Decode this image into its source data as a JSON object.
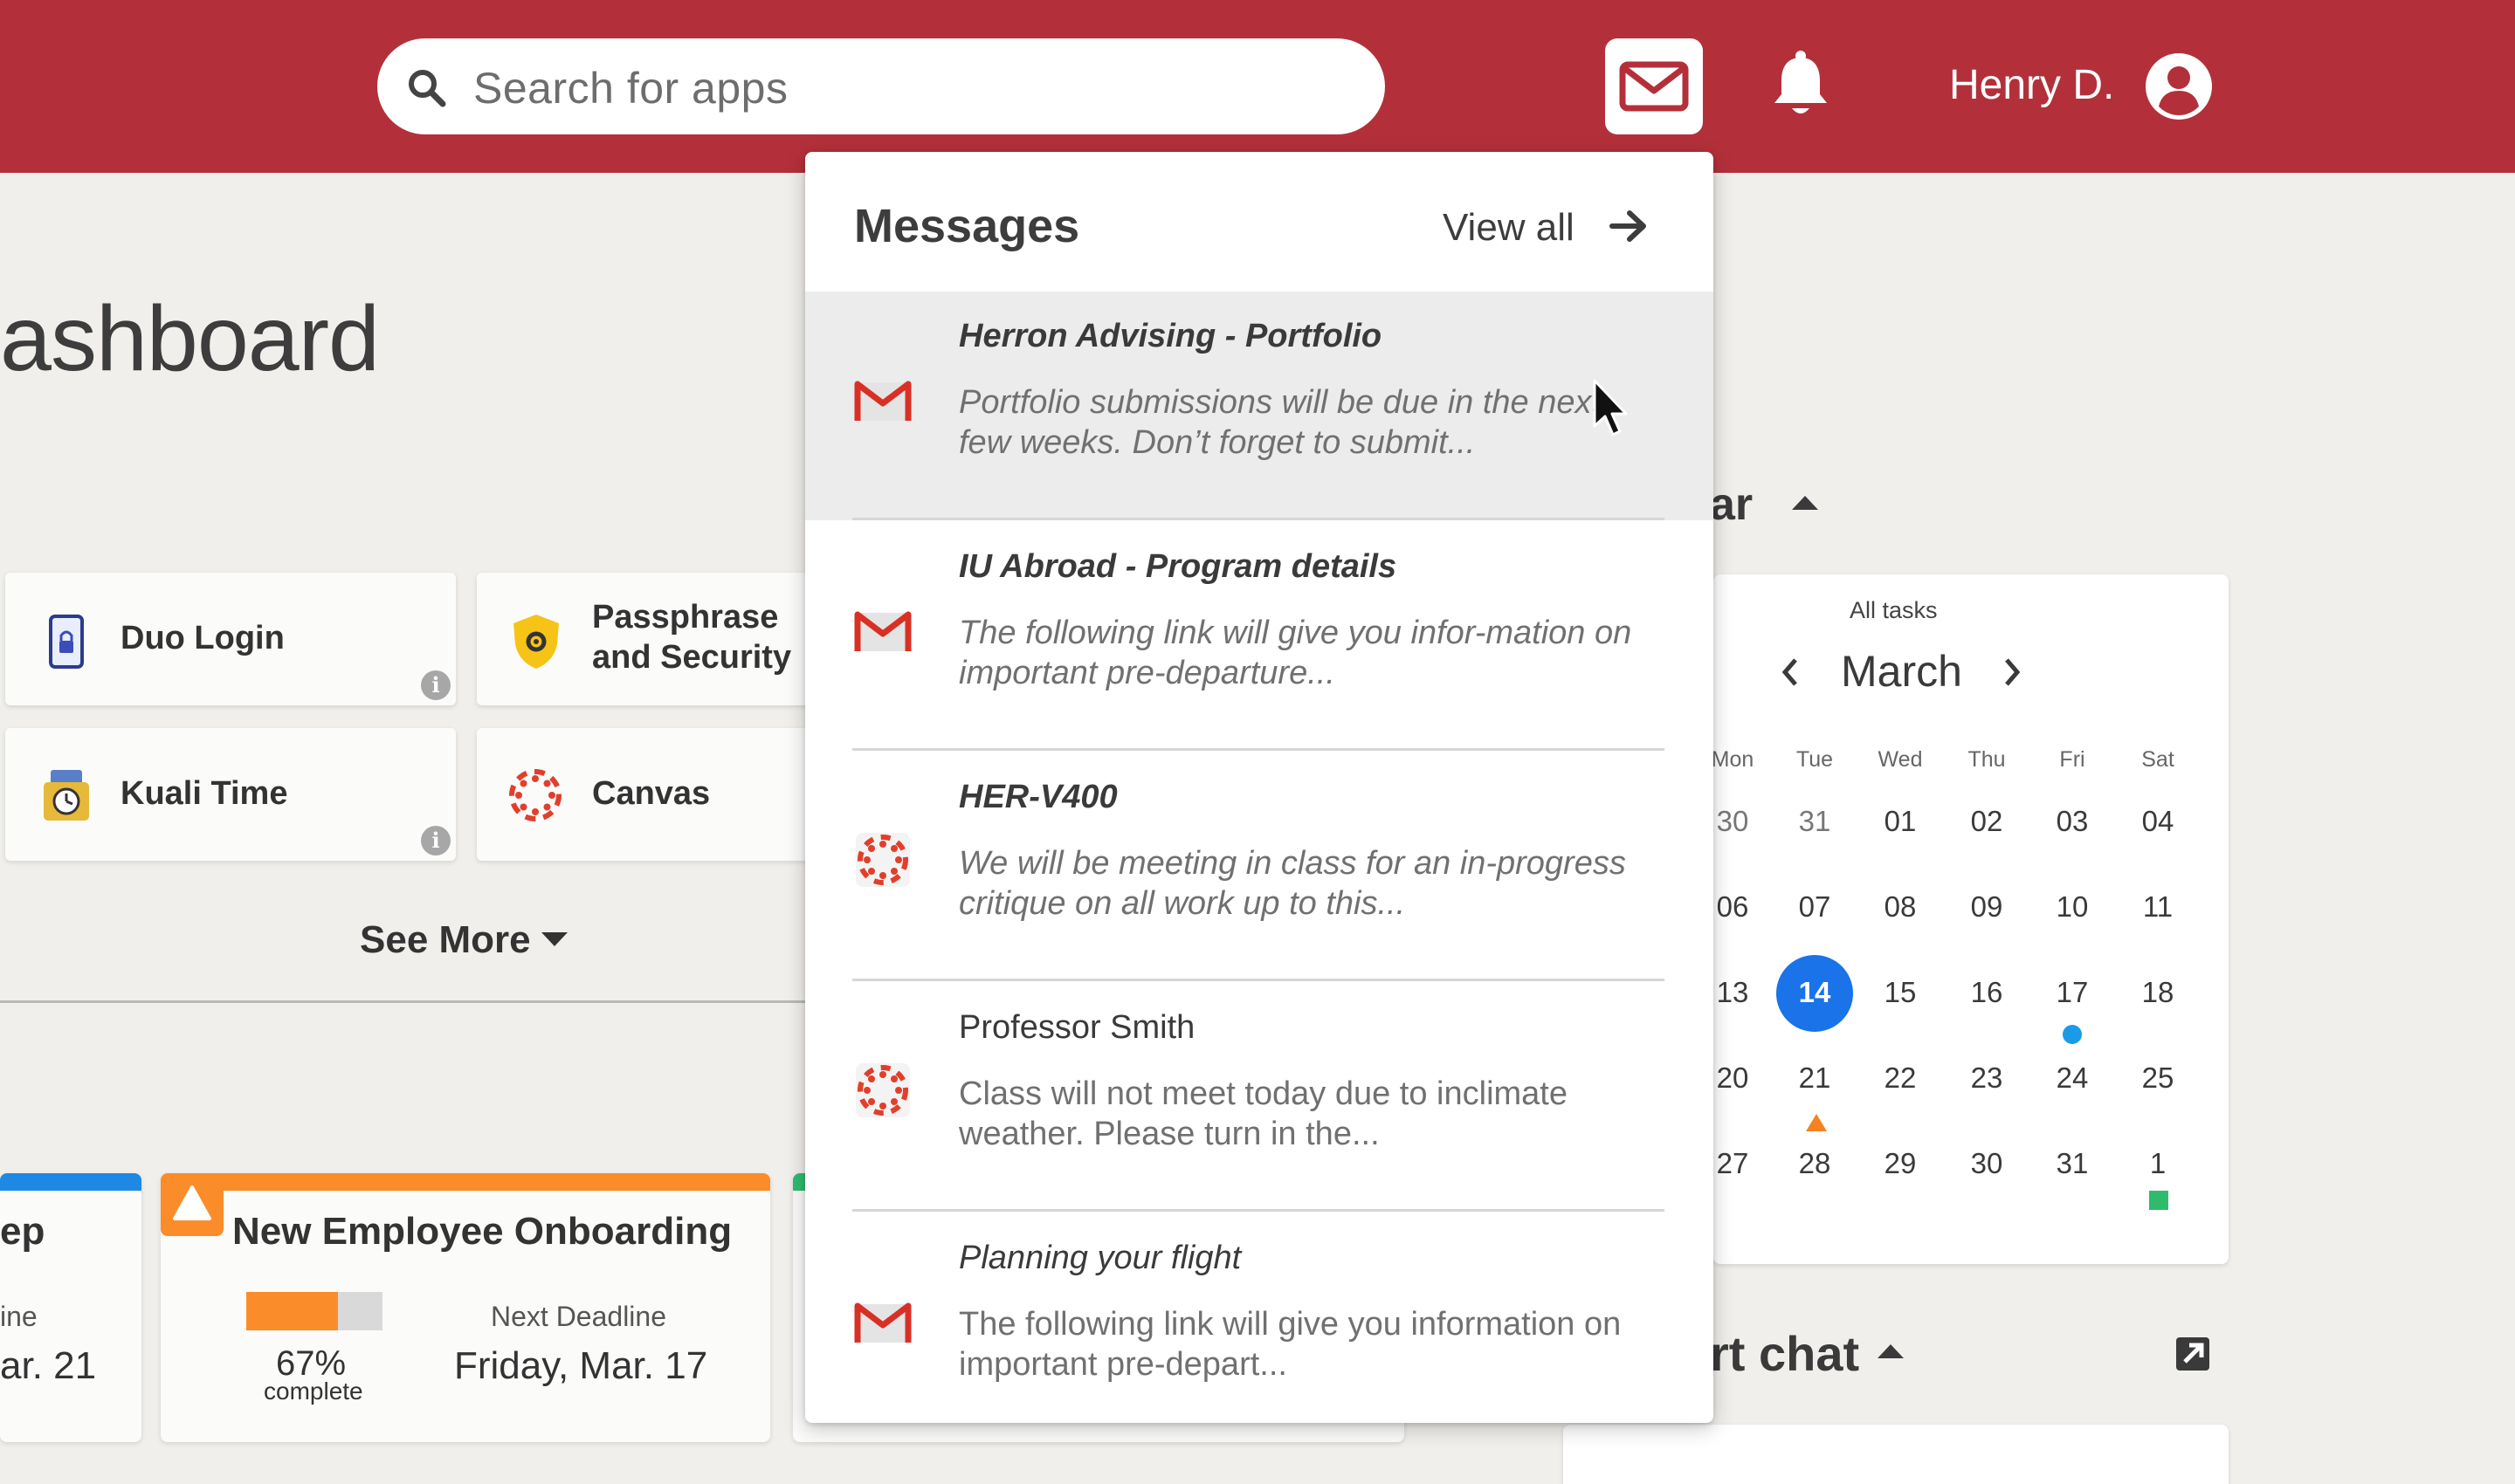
{
  "topbar": {
    "search_placeholder": "Search for apps",
    "user_name": "Henry D.",
    "icons": [
      "search-icon",
      "mail-icon",
      "bell-icon",
      "user-avatar-icon"
    ],
    "brand_color": "#b3303a"
  },
  "dashboard": {
    "title": "ashboard",
    "apps": [
      {
        "label": "Duo Login",
        "icon": "phone-lock-icon"
      },
      {
        "label": "Passphrase and Security",
        "icon": "shield-gear-icon"
      },
      {
        "label": "Kuali Time",
        "icon": "time-clock-icon"
      },
      {
        "label": "Canvas",
        "icon": "canvas-logo-icon"
      }
    ],
    "see_more": "See More",
    "tasks": [
      {
        "title": "ep",
        "label": "ine",
        "deadline": "ar. 21",
        "bar_color": "#1e88e5"
      },
      {
        "title": "New Employee Onboarding",
        "progress_percent": 67,
        "progress_text": "67%",
        "progress_sub": "complete",
        "deadline_label": "Next Deadline",
        "deadline": "Friday, Mar. 17",
        "bar_color": "#fb8c2a"
      },
      {
        "title": "",
        "bar_color": "#2ebb6e"
      }
    ]
  },
  "calendar": {
    "heading": "ar",
    "filter": "All tasks",
    "month": "March",
    "weekdays": [
      "Mon",
      "Tue",
      "Wed",
      "Thu",
      "Fri",
      "Sat"
    ],
    "weeks": [
      [
        "30",
        "31",
        "01",
        "02",
        "03",
        "04"
      ],
      [
        "06",
        "07",
        "08",
        "09",
        "10",
        "11"
      ],
      [
        "13",
        "14",
        "15",
        "16",
        "17",
        "18"
      ],
      [
        "20",
        "21",
        "22",
        "23",
        "24",
        "25"
      ],
      [
        "27",
        "28",
        "29",
        "30",
        "31",
        "1"
      ]
    ],
    "today": "14",
    "marker_colors": {
      "blue": "#1a9be8",
      "orange": "#f58220",
      "green": "#2ebb6e"
    }
  },
  "chat": {
    "heading": "rt chat"
  },
  "messages": {
    "title": "Messages",
    "view_all": "View all",
    "items": [
      {
        "app": "gmail",
        "from": "Herron Advising - Portfolio",
        "preview": "Portfolio submissions will be due in the next few weeks. Don’t forget to submit...",
        "unread": true,
        "active": true
      },
      {
        "app": "gmail",
        "from": "IU Abroad - Program details",
        "preview": "The following link will give you infor-mation on important pre-departure...",
        "unread": true
      },
      {
        "app": "canvas",
        "from": "HER-V400",
        "preview": "We will be meeting in class for an in-progress critique on all work up to this...",
        "unread": true
      },
      {
        "app": "canvas",
        "from": "Professor Smith",
        "preview": "Class will not meet today due to inclimate weather. Please turn in the...",
        "unread": false
      },
      {
        "app": "gmail",
        "from": "Planning your flight",
        "preview": "The following link will give you information on important pre-depart...",
        "unread": false
      }
    ]
  }
}
